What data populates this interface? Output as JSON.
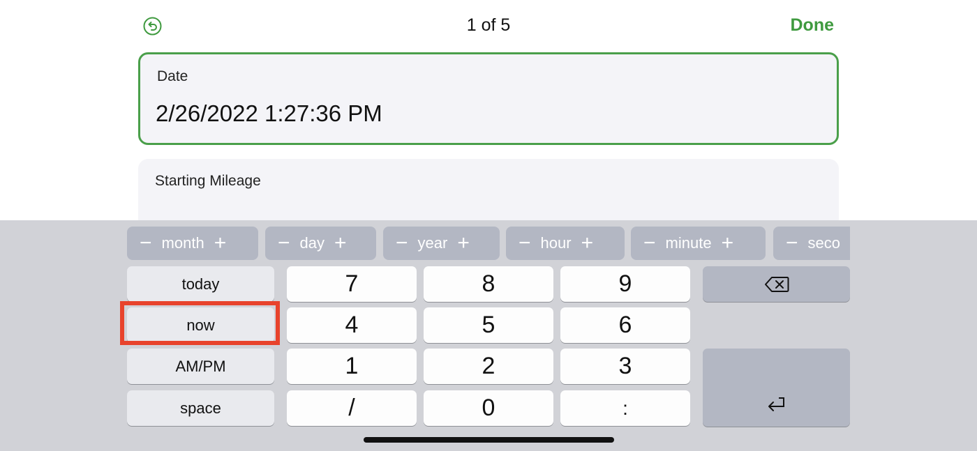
{
  "header": {
    "back_icon": "counterclockwise-arrow-circle-icon",
    "title": "1 of 5",
    "done_label": "Done",
    "accent_color": "#3f9a3f"
  },
  "fields": [
    {
      "label": "Date",
      "value": "2/26/2022 1:27:36 PM",
      "focused": true
    },
    {
      "label": "Starting Mileage",
      "value": ""
    }
  ],
  "keyboard": {
    "steppers": [
      {
        "label": "month",
        "minus": "−",
        "plus": "+"
      },
      {
        "label": "day",
        "minus": "−",
        "plus": "+"
      },
      {
        "label": "year",
        "minus": "−",
        "plus": "+"
      },
      {
        "label": "hour",
        "minus": "−",
        "plus": "+"
      },
      {
        "label": "minute",
        "minus": "−",
        "plus": "+"
      },
      {
        "label": "seco",
        "minus": "−",
        "plus": "+"
      }
    ],
    "left_keys": [
      "today",
      "now",
      "AM/PM",
      "space"
    ],
    "num_keys": [
      "7",
      "8",
      "9",
      "4",
      "5",
      "6",
      "1",
      "2",
      "3",
      "/",
      "0",
      ":"
    ],
    "delete_icon": "backspace-icon",
    "return_icon": "return-icon",
    "highlighted_key": "now",
    "highlight_color": "#e8432c"
  }
}
